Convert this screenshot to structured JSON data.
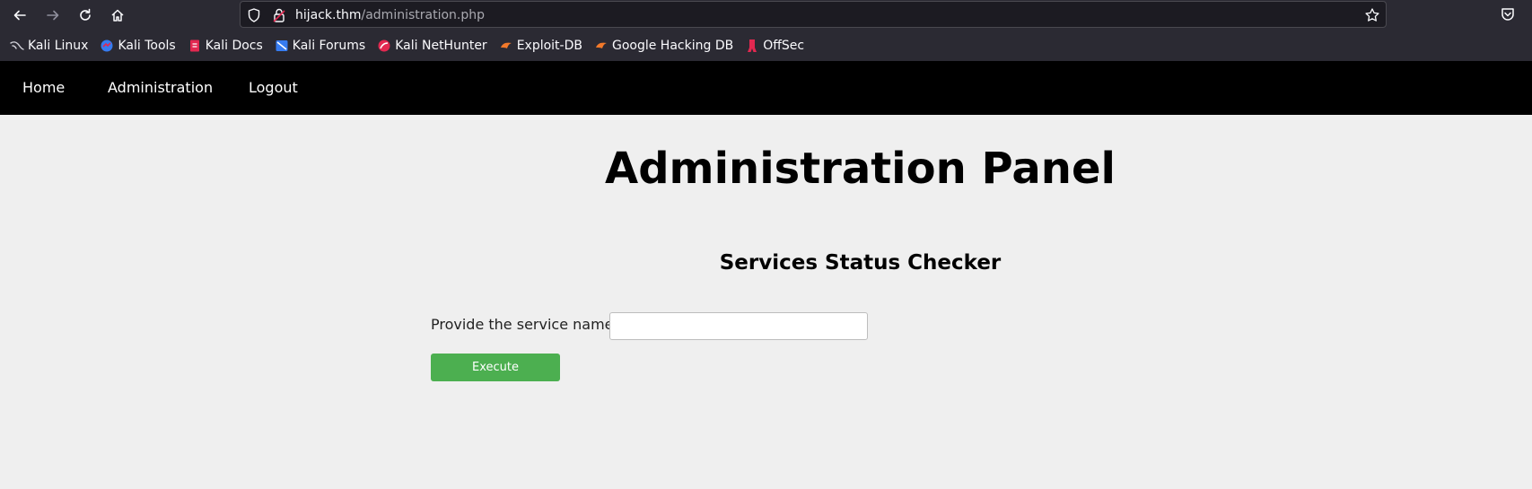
{
  "browser": {
    "url_host": "hijack.thm",
    "url_path": "/administration.php",
    "bookmarks": [
      {
        "label": "Kali Linux",
        "icon": "kali-dragon-icon"
      },
      {
        "label": "Kali Tools",
        "icon": "kali-tools-icon"
      },
      {
        "label": "Kali Docs",
        "icon": "kali-docs-icon"
      },
      {
        "label": "Kali Forums",
        "icon": "kali-forums-icon"
      },
      {
        "label": "Kali NetHunter",
        "icon": "nethunter-icon"
      },
      {
        "label": "Exploit-DB",
        "icon": "exploit-db-icon"
      },
      {
        "label": "Google Hacking DB",
        "icon": "ghdb-icon"
      },
      {
        "label": "OffSec",
        "icon": "offsec-icon"
      }
    ]
  },
  "nav": {
    "home": "Home",
    "administration": "Administration",
    "logout": "Logout"
  },
  "main": {
    "title": "Administration Panel",
    "subtitle": "Services Status Checker",
    "field_label": "Provide the service name :",
    "service_value": "",
    "button_label": "Execute"
  },
  "colors": {
    "chrome": "#2b2a33",
    "nav_bg": "#000000",
    "page_bg": "#efefef",
    "button": "#4caf50"
  }
}
